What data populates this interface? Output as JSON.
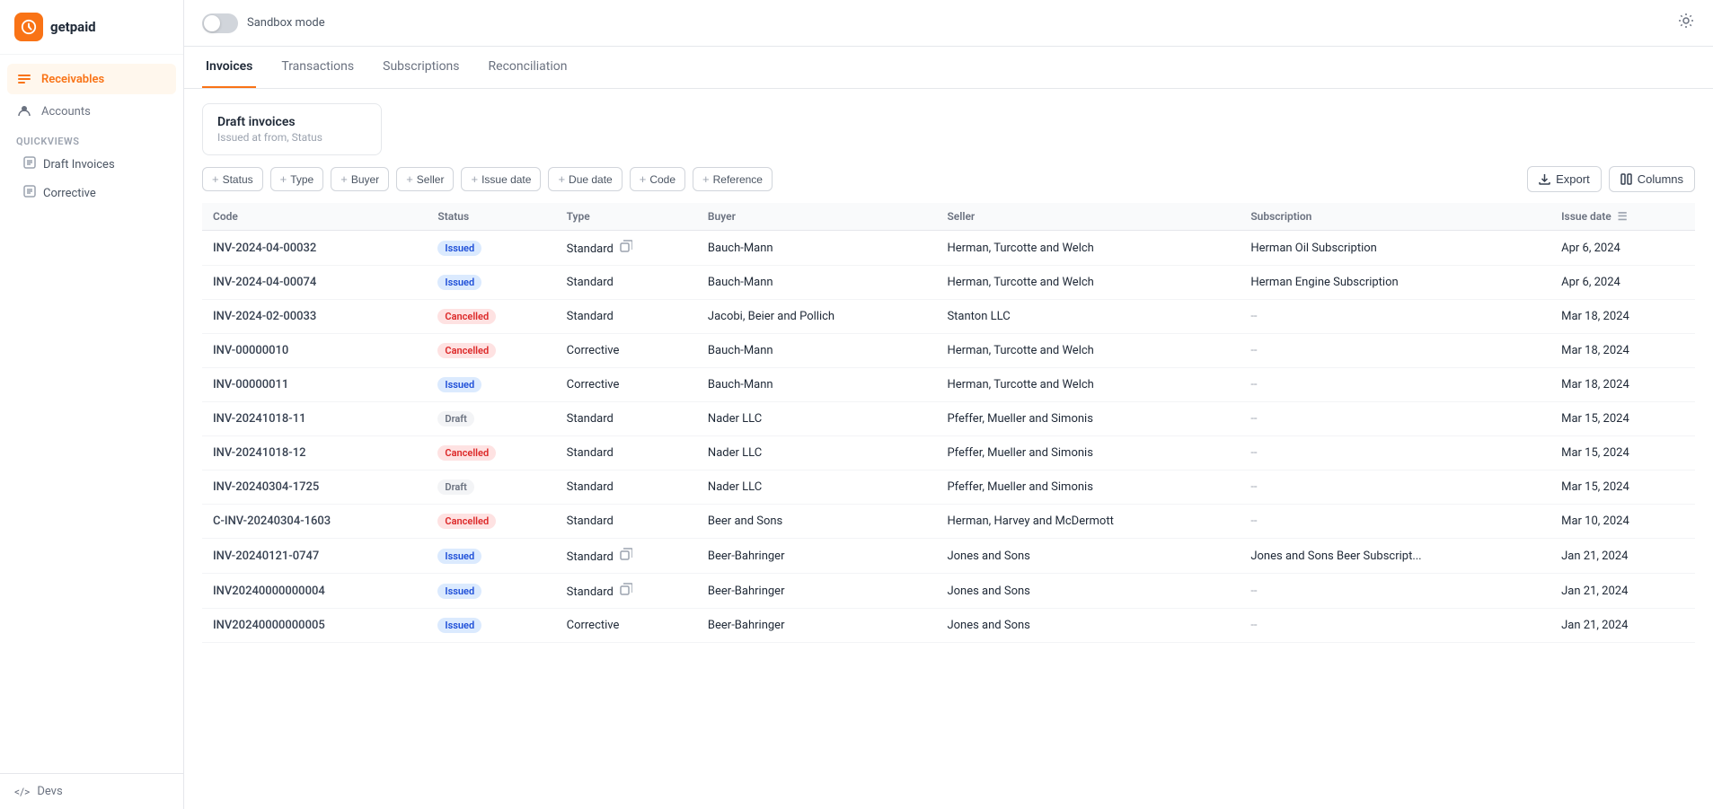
{
  "app": {
    "name": "getpaid",
    "logo_alt": "getpaid logo"
  },
  "sidebar": {
    "nav_items": [
      {
        "id": "receivables",
        "label": "Receivables",
        "active": true
      },
      {
        "id": "accounts",
        "label": "Accounts",
        "active": false
      }
    ],
    "quickviews_label": "Quickviews",
    "quickview_items": [
      {
        "id": "draft-invoices",
        "label": "Draft Invoices"
      },
      {
        "id": "corrective",
        "label": "Corrective"
      }
    ],
    "footer": {
      "devs_label": "</> Devs"
    }
  },
  "topbar": {
    "sandbox_label": "Sandbox mode",
    "settings_tooltip": "Settings"
  },
  "tabs": [
    {
      "id": "invoices",
      "label": "Invoices",
      "active": true
    },
    {
      "id": "transactions",
      "label": "Transactions",
      "active": false
    },
    {
      "id": "subscriptions",
      "label": "Subscriptions",
      "active": false
    },
    {
      "id": "reconciliation",
      "label": "Reconciliation",
      "active": false
    }
  ],
  "draft_card": {
    "title": "Draft invoices",
    "subtitle": "Issued at from, Status"
  },
  "filters": [
    {
      "id": "status",
      "label": "Status"
    },
    {
      "id": "type",
      "label": "Type"
    },
    {
      "id": "buyer",
      "label": "Buyer"
    },
    {
      "id": "seller",
      "label": "Seller"
    },
    {
      "id": "issue-date",
      "label": "Issue date"
    },
    {
      "id": "due-date",
      "label": "Due date"
    },
    {
      "id": "code",
      "label": "Code"
    },
    {
      "id": "reference",
      "label": "Reference"
    }
  ],
  "actions": {
    "export_label": "Export",
    "columns_label": "Columns"
  },
  "table": {
    "columns": [
      {
        "id": "code",
        "label": "Code"
      },
      {
        "id": "status",
        "label": "Status"
      },
      {
        "id": "type",
        "label": "Type"
      },
      {
        "id": "buyer",
        "label": "Buyer"
      },
      {
        "id": "seller",
        "label": "Seller"
      },
      {
        "id": "subscription",
        "label": "Subscription"
      },
      {
        "id": "issue_date",
        "label": "Issue date"
      }
    ],
    "rows": [
      {
        "code": "INV-2024-04-00032",
        "status": "Issued",
        "status_type": "issued",
        "type": "Standard",
        "has_copy": true,
        "buyer": "Bauch-Mann",
        "seller": "Herman, Turcotte and Welch",
        "subscription": "Herman Oil Subscription",
        "issue_date": "Apr 6, 2024"
      },
      {
        "code": "INV-2024-04-00074",
        "status": "Issued",
        "status_type": "issued",
        "type": "Standard",
        "has_copy": false,
        "buyer": "Bauch-Mann",
        "seller": "Herman, Turcotte and Welch",
        "subscription": "Herman Engine Subscription",
        "issue_date": "Apr 6, 2024"
      },
      {
        "code": "INV-2024-02-00033",
        "status": "Cancelled",
        "status_type": "cancelled",
        "type": "Standard",
        "has_copy": false,
        "buyer": "Jacobi, Beier and Pollich",
        "seller": "Stanton LLC",
        "subscription": "--",
        "issue_date": "Mar 18, 2024"
      },
      {
        "code": "INV-00000010",
        "status": "Cancelled",
        "status_type": "cancelled",
        "type": "Corrective",
        "has_copy": false,
        "buyer": "Bauch-Mann",
        "seller": "Herman, Turcotte and Welch",
        "subscription": "--",
        "issue_date": "Mar 18, 2024"
      },
      {
        "code": "INV-00000011",
        "status": "Issued",
        "status_type": "issued",
        "type": "Corrective",
        "has_copy": false,
        "buyer": "Bauch-Mann",
        "seller": "Herman, Turcotte and Welch",
        "subscription": "--",
        "issue_date": "Mar 18, 2024"
      },
      {
        "code": "INV-20241018-11",
        "status": "Draft",
        "status_type": "draft",
        "type": "Standard",
        "has_copy": false,
        "buyer": "Nader LLC",
        "seller": "Pfeffer, Mueller and Simonis",
        "subscription": "--",
        "issue_date": "Mar 15, 2024"
      },
      {
        "code": "INV-20241018-12",
        "status": "Cancelled",
        "status_type": "cancelled",
        "type": "Standard",
        "has_copy": false,
        "buyer": "Nader LLC",
        "seller": "Pfeffer, Mueller and Simonis",
        "subscription": "--",
        "issue_date": "Mar 15, 2024"
      },
      {
        "code": "INV-20240304-1725",
        "status": "Draft",
        "status_type": "draft",
        "type": "Standard",
        "has_copy": false,
        "buyer": "Nader LLC",
        "seller": "Pfeffer, Mueller and Simonis",
        "subscription": "--",
        "issue_date": "Mar 15, 2024"
      },
      {
        "code": "C-INV-20240304-1603",
        "status": "Cancelled",
        "status_type": "cancelled",
        "type": "Standard",
        "has_copy": false,
        "buyer": "Beer and Sons",
        "seller": "Herman, Harvey and McDermott",
        "subscription": "--",
        "issue_date": "Mar 10, 2024"
      },
      {
        "code": "INV-20240121-0747",
        "status": "Issued",
        "status_type": "issued",
        "type": "Standard",
        "has_copy": true,
        "buyer": "Beer-Bahringer",
        "seller": "Jones and Sons",
        "subscription": "Jones and Sons Beer Subscript...",
        "issue_date": "Jan 21, 2024"
      },
      {
        "code": "INV20240000000004",
        "status": "Issued",
        "status_type": "issued",
        "type": "Standard",
        "has_copy": true,
        "buyer": "Beer-Bahringer",
        "seller": "Jones and Sons",
        "subscription": "--",
        "issue_date": "Jan 21, 2024"
      },
      {
        "code": "INV20240000000005",
        "status": "Issued",
        "status_type": "issued",
        "type": "Corrective",
        "has_copy": false,
        "buyer": "Beer-Bahringer",
        "seller": "Jones and Sons",
        "subscription": "--",
        "issue_date": "Jan 21, 2024"
      }
    ]
  }
}
